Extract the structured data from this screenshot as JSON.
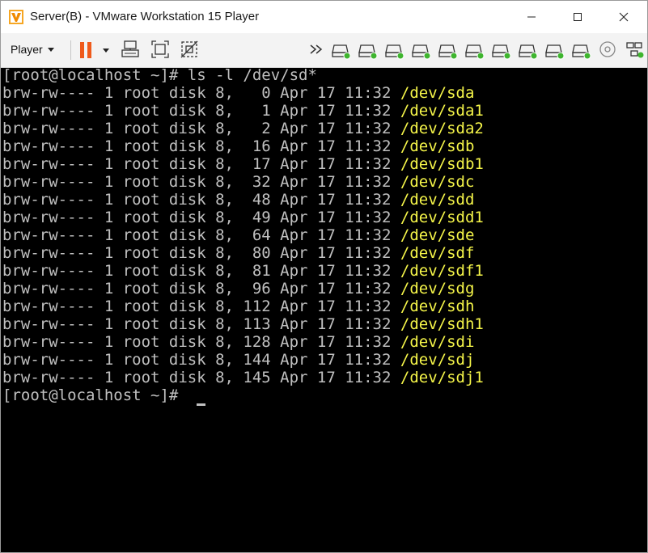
{
  "window": {
    "title": "Server(B) - VMware Workstation 15 Player"
  },
  "toolbar": {
    "player_label": "Player",
    "icons": [
      "pause-icon",
      "send-ctrl-alt-del-icon",
      "fit-guest-icon",
      "unity-icon",
      "more-devices-icon",
      "hard-disk-icon",
      "cd-dvd-icon",
      "network-adapter-icon",
      "settings-icon"
    ]
  },
  "terminal": {
    "text_color": "#c0c0c0",
    "path_color": "#f5f549",
    "background": "#000000",
    "command": "[root@localhost ~]# ls -l /dev/sd*",
    "final_prompt": "[root@localhost ~]# ",
    "rows": [
      {
        "info": "brw-rw---- 1 root disk 8,   0 Apr 17 11:32 ",
        "path": "/dev/sda"
      },
      {
        "info": "brw-rw---- 1 root disk 8,   1 Apr 17 11:32 ",
        "path": "/dev/sda1"
      },
      {
        "info": "brw-rw---- 1 root disk 8,   2 Apr 17 11:32 ",
        "path": "/dev/sda2"
      },
      {
        "info": "brw-rw---- 1 root disk 8,  16 Apr 17 11:32 ",
        "path": "/dev/sdb"
      },
      {
        "info": "brw-rw---- 1 root disk 8,  17 Apr 17 11:32 ",
        "path": "/dev/sdb1"
      },
      {
        "info": "brw-rw---- 1 root disk 8,  32 Apr 17 11:32 ",
        "path": "/dev/sdc"
      },
      {
        "info": "brw-rw---- 1 root disk 8,  48 Apr 17 11:32 ",
        "path": "/dev/sdd"
      },
      {
        "info": "brw-rw---- 1 root disk 8,  49 Apr 17 11:32 ",
        "path": "/dev/sdd1"
      },
      {
        "info": "brw-rw---- 1 root disk 8,  64 Apr 17 11:32 ",
        "path": "/dev/sde"
      },
      {
        "info": "brw-rw---- 1 root disk 8,  80 Apr 17 11:32 ",
        "path": "/dev/sdf"
      },
      {
        "info": "brw-rw---- 1 root disk 8,  81 Apr 17 11:32 ",
        "path": "/dev/sdf1"
      },
      {
        "info": "brw-rw---- 1 root disk 8,  96 Apr 17 11:32 ",
        "path": "/dev/sdg"
      },
      {
        "info": "brw-rw---- 1 root disk 8, 112 Apr 17 11:32 ",
        "path": "/dev/sdh"
      },
      {
        "info": "brw-rw---- 1 root disk 8, 113 Apr 17 11:32 ",
        "path": "/dev/sdh1"
      },
      {
        "info": "brw-rw---- 1 root disk 8, 128 Apr 17 11:32 ",
        "path": "/dev/sdi"
      },
      {
        "info": "brw-rw---- 1 root disk 8, 144 Apr 17 11:32 ",
        "path": "/dev/sdj"
      },
      {
        "info": "brw-rw---- 1 root disk 8, 145 Apr 17 11:32 ",
        "path": "/dev/sdj1"
      }
    ]
  }
}
